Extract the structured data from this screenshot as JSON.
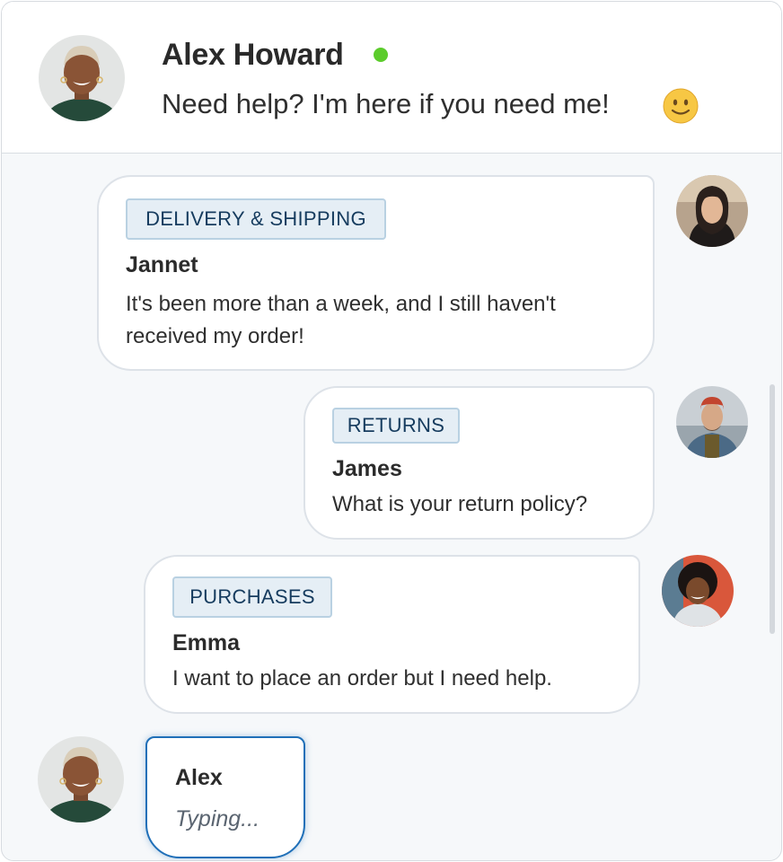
{
  "header": {
    "agent_name": "Alex Howard",
    "status_message": "Need help? I'm here if you need me!",
    "online_color": "#5ccc2c",
    "emoji_icon": "slightly-smiling-face-icon"
  },
  "messages": [
    {
      "tag": "DELIVERY & SHIPPING",
      "sender": "Jannet",
      "lines": [
        "It's been more than a week, and I still haven't",
        "received my order!"
      ]
    },
    {
      "tag": "RETURNS",
      "sender": "James",
      "lines": [
        "What is your return policy?"
      ]
    },
    {
      "tag": "PURCHASES",
      "sender": "Emma",
      "lines": [
        "I want to place an order but I need help."
      ]
    }
  ],
  "typing": {
    "sender": "Alex",
    "text": "Typing..."
  },
  "colors": {
    "tag_background": "#e5eef5",
    "tag_text": "#153b5e",
    "typing_border": "#1f6fb8"
  }
}
